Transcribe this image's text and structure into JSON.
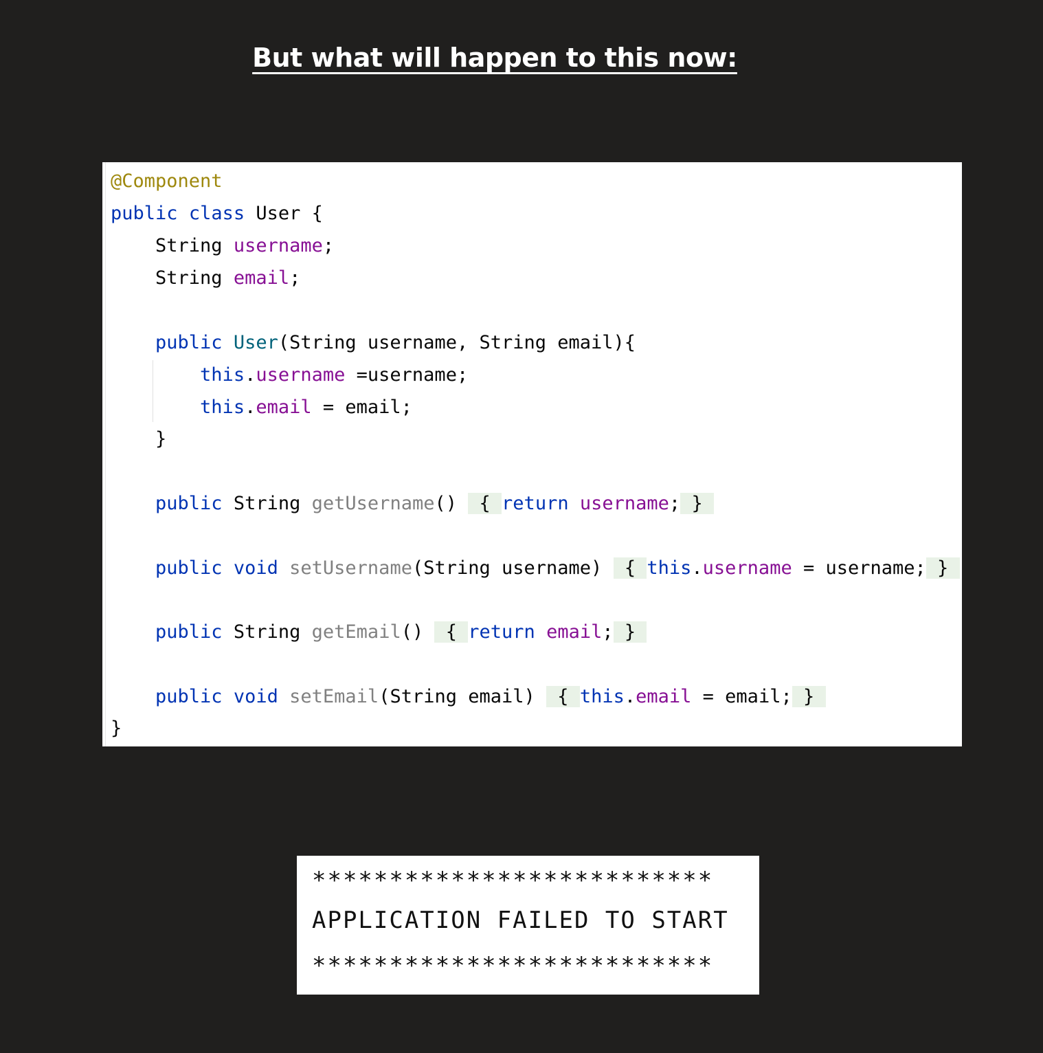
{
  "heading": "But what will happen to this now:",
  "code": {
    "annotation": "@Component",
    "class_line": {
      "kw1": "public",
      "kw2": "class",
      "name": "User",
      "brace": "{"
    },
    "field1": {
      "type": "String",
      "name": "username",
      "semi": ";"
    },
    "field2": {
      "type": "String",
      "name": "email",
      "semi": ";"
    },
    "ctor": {
      "kw": "public",
      "name": "User",
      "params": "(String username, String email){"
    },
    "assign1": {
      "this": "this",
      "dot": ".",
      "field": "username",
      "rest": " =username;"
    },
    "assign2": {
      "this": "this",
      "dot": ".",
      "field": "email",
      "rest": " = email;"
    },
    "ctor_close": "}",
    "getUsername": {
      "kw": "public",
      "type": "String",
      "name": "getUsername",
      "parens": "()",
      "open": "{",
      "ret": "return",
      "field": "username",
      "semi": ";",
      "close": "}"
    },
    "setUsername": {
      "kw1": "public",
      "kw2": "void",
      "name": "setUsername",
      "params": "(String username)",
      "open": "{",
      "this": "this",
      "dot": ".",
      "field": "username",
      "rest": " = username;",
      "close": "}"
    },
    "getEmail": {
      "kw": "public",
      "type": "String",
      "name": "getEmail",
      "parens": "()",
      "open": "{",
      "ret": "return",
      "field": "email",
      "semi": ";",
      "close": "}"
    },
    "setEmail": {
      "kw1": "public",
      "kw2": "void",
      "name": "setEmail",
      "params": "(String email)",
      "open": "{",
      "this": "this",
      "dot": ".",
      "field": "email",
      "rest": " = email;",
      "close": "}"
    },
    "class_close": "}"
  },
  "error": {
    "stars_top": "**************************",
    "message": "APPLICATION FAILED TO START",
    "stars_bottom": "**************************"
  },
  "colors": {
    "background": "#201f1e",
    "keyword": "#0033b3",
    "annotation": "#9e880d",
    "field": "#871094",
    "method_decl": "#808080",
    "constructor": "#00627a",
    "fold_highlight": "#e9f2e7"
  }
}
